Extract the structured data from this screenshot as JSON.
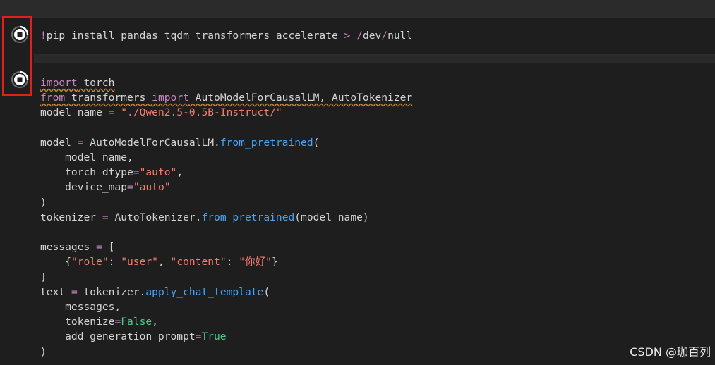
{
  "cell1": {
    "code": "!pip install pandas tqdm transformers accelerate > /dev/null"
  },
  "cell2": {
    "lines": [
      "import torch",
      "from transformers import AutoModelForCausalLM, AutoTokenizer",
      "model_name = \"./Qwen2.5-0.5B-Instruct/\"",
      "",
      "model = AutoModelForCausalLM.from_pretrained(",
      "    model_name,",
      "    torch_dtype=\"auto\",",
      "    device_map=\"auto\"",
      ")",
      "tokenizer = AutoTokenizer.from_pretrained(model_name)",
      "",
      "messages = [",
      "    {\"role\": \"user\", \"content\": \"你好\"}",
      "]",
      "text = tokenizer.apply_chat_template(",
      "    messages,",
      "    tokenize=False,",
      "    add_generation_prompt=True",
      ")"
    ]
  },
  "icons": {
    "run_cell_1": "stop-execution-icon",
    "run_cell_2": "stop-execution-icon"
  },
  "colors": {
    "highlight": "#e0201b",
    "keyword": "#c586c0",
    "string": "#f47b70",
    "function": "#4aa3f5",
    "constant": "#4ec98a"
  },
  "watermark": "CSDN @珈百列"
}
